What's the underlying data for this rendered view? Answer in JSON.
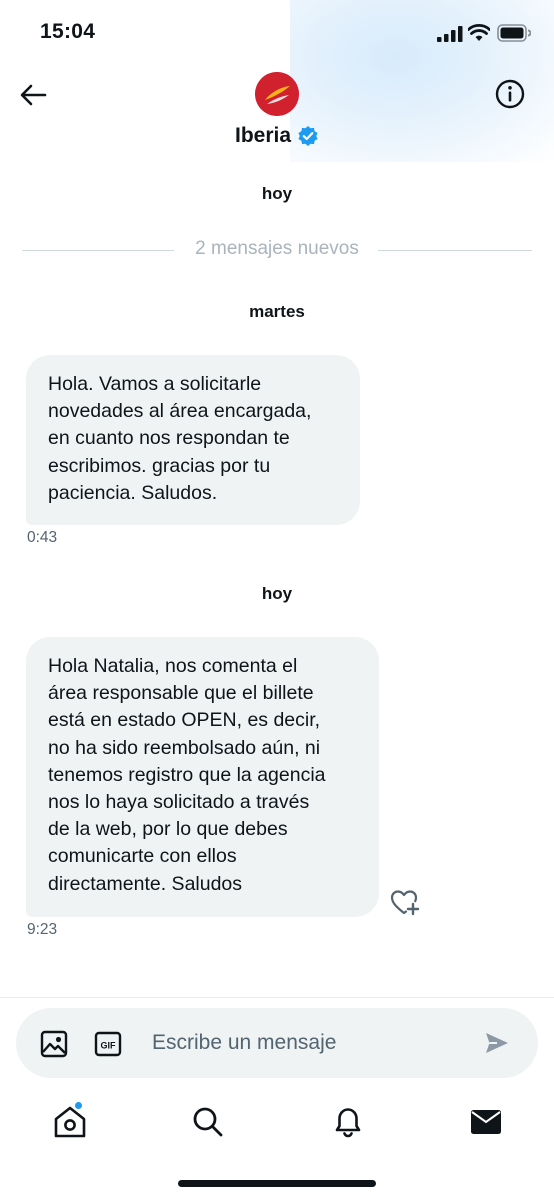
{
  "status_bar": {
    "time": "15:04"
  },
  "header": {
    "name": "Iberia",
    "verified": true
  },
  "conversation": {
    "date_today_top": "hoy",
    "new_messages": "2 mensajes nuevos",
    "date_tuesday": "martes",
    "message_1": {
      "text": "Hola. Vamos a solicitarle\nnovedades al área encargada,\nen cuanto nos respondan te\nescribimos. gracias por tu\npaciencia. Saludos.",
      "time": "0:43"
    },
    "date_today": "hoy",
    "message_2": {
      "text": "Hola Natalia, nos comenta el\nárea responsable que el billete\nestá en estado OPEN, es decir,\nno ha sido reembolsado aún, ni\ntenemos registro que la agencia\nnos lo haya solicitado a través\nde la web, por lo que debes\ncomunicarte con ellos\ndirectamente. Saludos",
      "time": "9:23"
    }
  },
  "composer": {
    "placeholder": "Escribe un mensaje",
    "gif_label": "GIF"
  },
  "tabs": [
    {
      "icon": "home-icon",
      "has_notification_dot": true
    },
    {
      "icon": "search-icon"
    },
    {
      "icon": "bell-icon"
    },
    {
      "icon": "mail-icon",
      "active": true
    }
  ],
  "colors": {
    "accent": "#1d9bf0",
    "verified": "#1d9bf0",
    "bubble": "#eff3f4",
    "brand_red": "#d1202e"
  }
}
